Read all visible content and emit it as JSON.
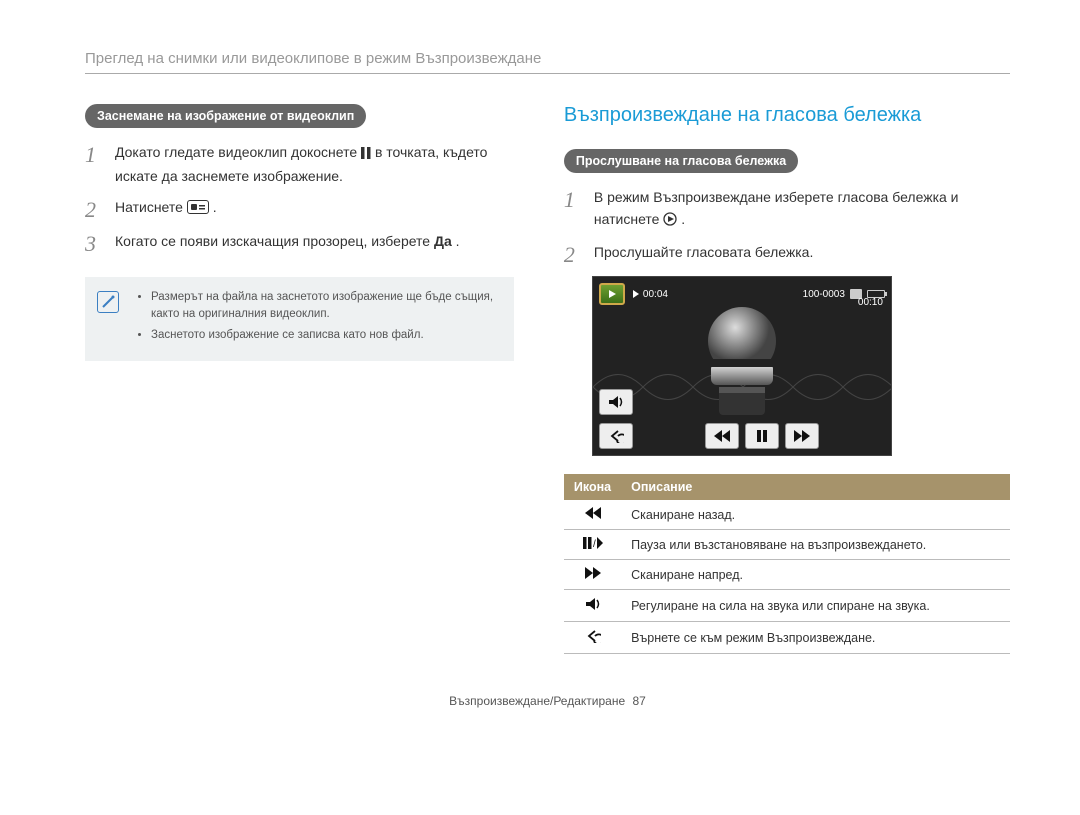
{
  "page_title": "Преглед на снимки или видеоклипове в режим Възпроизвеждане",
  "left": {
    "section_label": "Заснемане на изображение от видеоклип",
    "steps": [
      {
        "pre": "Докато гледате видеоклип докоснете ",
        "post": " в точката, където искате да заснемете изображение."
      },
      {
        "pre": "Натиснете ",
        "post": "."
      },
      {
        "pre": "Когато се появи изскачащия прозорец, изберете ",
        "bold": "Да",
        "post": "."
      }
    ],
    "notes": [
      "Размерът на файла на заснетото изображение ще бъде същия, както на оригиналния видеоклип.",
      "Заснетото изображение се записва като нов файл."
    ]
  },
  "right": {
    "heading": "Възпроизвеждане на гласова бележка",
    "section_label": "Прослушване на гласова бележка",
    "steps": [
      {
        "pre": "В режим Възпроизвеждане изберете гласова бележка и натиснете ",
        "post": "."
      },
      {
        "pre": "Прослушайте гласовата бележка."
      }
    ],
    "player": {
      "elapsed": "00:04",
      "file_no": "100-0003",
      "total": "00:10"
    },
    "table": {
      "header_icon": "Икона",
      "header_desc": "Описание",
      "rows": [
        {
          "icon": "rewind",
          "desc": "Сканиране назад."
        },
        {
          "icon": "pause-play",
          "desc": "Пауза или възстановяване на възпроизвеждането."
        },
        {
          "icon": "forward",
          "desc": "Сканиране напред."
        },
        {
          "icon": "volume",
          "desc": "Регулиране на сила на звука или спиране на звука."
        },
        {
          "icon": "back",
          "desc": "Върнете се към режим Възпроизвеждане."
        }
      ]
    }
  },
  "footer": {
    "section": "Възпроизвеждане/Редактиране",
    "page": "87"
  }
}
